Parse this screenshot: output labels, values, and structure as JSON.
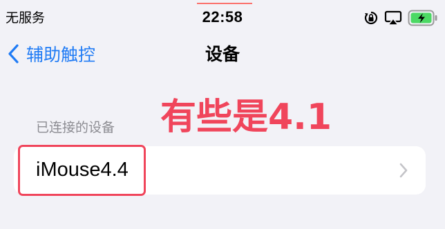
{
  "status_bar": {
    "carrier": "无服务",
    "time": "22:58",
    "icons": [
      "orientation-lock-icon",
      "airplay-icon",
      "battery-charging-icon"
    ],
    "battery_color": "#4cd964"
  },
  "nav": {
    "back_label": "辅助触控",
    "title": "设备",
    "accent_color": "#1f7bf5"
  },
  "annotation": {
    "text": "有些是4.1",
    "color": "#f0455b"
  },
  "section": {
    "header": "已连接的设备",
    "devices": [
      {
        "name": "iMouse4.4"
      }
    ]
  }
}
